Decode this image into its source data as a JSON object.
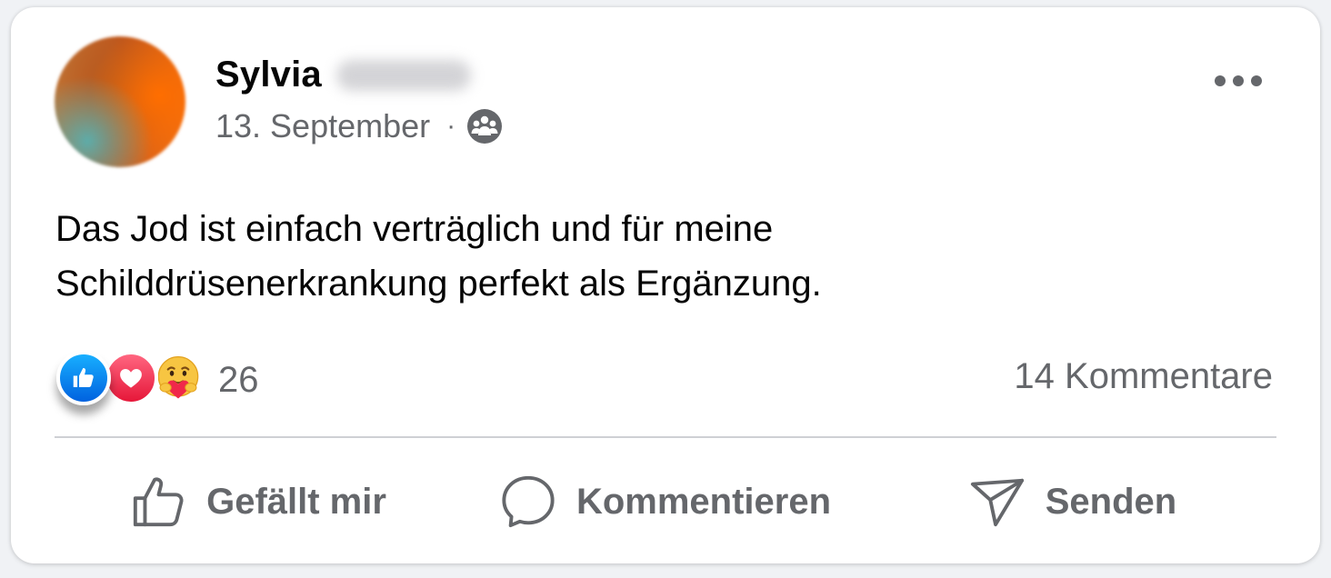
{
  "post": {
    "author_first_name": "Sylvia",
    "date": "13. September",
    "separator": "·",
    "audience_icon": "group-icon",
    "text": "Das Jod ist einfach verträglich und für meine\nSchilddrüsenerkrankung perfekt als Ergänzung.",
    "more_icon": "more-options-icon"
  },
  "reactions": {
    "types": [
      "like",
      "love",
      "care"
    ],
    "count": "26",
    "comments": "14 Kommentare"
  },
  "actions": {
    "like_label": "Gefällt mir",
    "comment_label": "Kommentieren",
    "share_label": "Senden"
  },
  "colors": {
    "text_primary": "#050505",
    "text_secondary": "#65676b",
    "like_blue": "#0866ff",
    "love_red": "#f33e58",
    "divider": "#ced0d4"
  }
}
